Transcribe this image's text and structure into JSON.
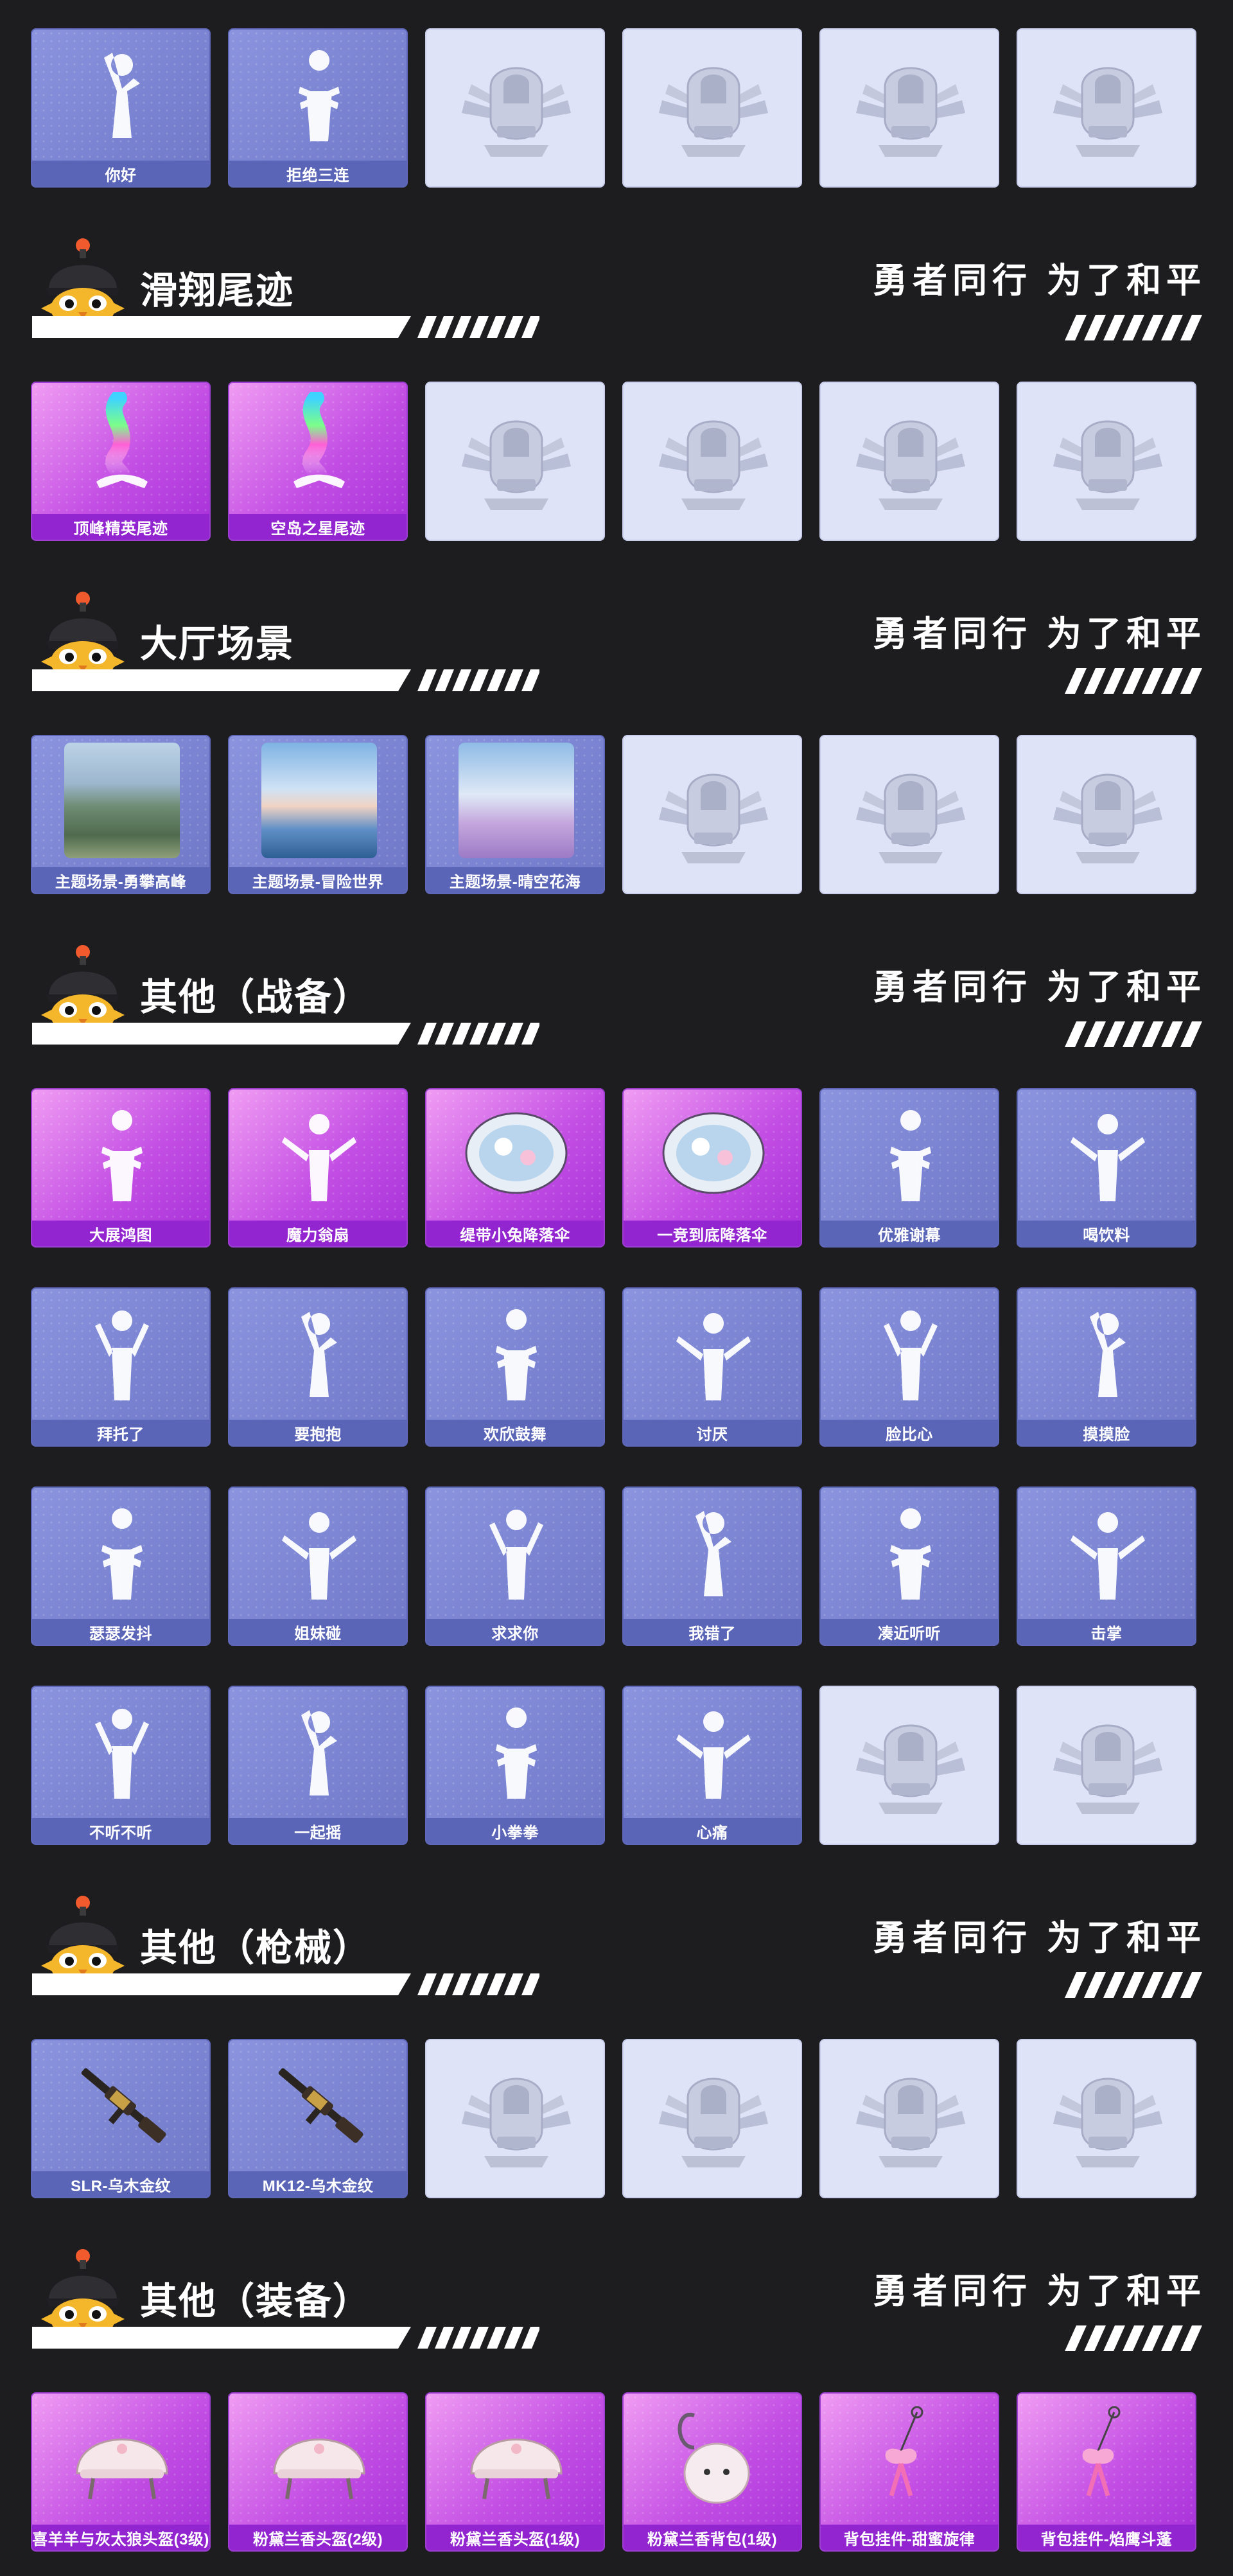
{
  "slogan": "勇者同行 为了和平",
  "sections": [
    {
      "title": "",
      "items": [
        {
          "label": "你好",
          "style": "blue",
          "icon": "wave-emote-icon"
        },
        {
          "label": "拒绝三连",
          "style": "blue",
          "icon": "crossed-arms-emote-icon"
        },
        {
          "label": "",
          "style": "empty",
          "icon": "helmet-emblem-icon"
        },
        {
          "label": "",
          "style": "empty",
          "icon": "helmet-emblem-icon"
        },
        {
          "label": "",
          "style": "empty",
          "icon": "helmet-emblem-icon"
        },
        {
          "label": "",
          "style": "empty",
          "icon": "helmet-emblem-icon"
        }
      ]
    },
    {
      "title": "滑翔尾迹",
      "items": [
        {
          "label": "顶峰精英尾迹",
          "style": "purple",
          "icon": "glide-trail-icon"
        },
        {
          "label": "空岛之星尾迹",
          "style": "purple",
          "icon": "glide-trail-icon"
        },
        {
          "label": "",
          "style": "empty",
          "icon": "helmet-emblem-icon"
        },
        {
          "label": "",
          "style": "empty",
          "icon": "helmet-emblem-icon"
        },
        {
          "label": "",
          "style": "empty",
          "icon": "helmet-emblem-icon"
        },
        {
          "label": "",
          "style": "empty",
          "icon": "helmet-emblem-icon"
        }
      ]
    },
    {
      "title": "大厅场景",
      "items": [
        {
          "label": "主题场景-勇攀高峰",
          "style": "blue",
          "icon": "mountain-scene-icon"
        },
        {
          "label": "主题场景-冒险世界",
          "style": "blue",
          "icon": "ocean-scene-icon"
        },
        {
          "label": "主题场景-晴空花海",
          "style": "blue",
          "icon": "flower-field-scene-icon"
        },
        {
          "label": "",
          "style": "empty",
          "icon": "helmet-emblem-icon"
        },
        {
          "label": "",
          "style": "empty",
          "icon": "helmet-emblem-icon"
        },
        {
          "label": "",
          "style": "empty",
          "icon": "helmet-emblem-icon"
        }
      ]
    },
    {
      "title": "其他（战备）",
      "items": [
        {
          "label": "大展鸿图",
          "style": "purple",
          "icon": "emote-icon"
        },
        {
          "label": "魔力翁扇",
          "style": "purple",
          "icon": "emote-icon"
        },
        {
          "label": "缇带小兔降落伞",
          "style": "purple",
          "icon": "parachute-icon"
        },
        {
          "label": "一竞到底降落伞",
          "style": "purple",
          "icon": "parachute-icon"
        },
        {
          "label": "优雅谢幕",
          "style": "blue",
          "icon": "bow-emote-icon"
        },
        {
          "label": "喝饮料",
          "style": "blue",
          "icon": "emote-icon"
        },
        {
          "label": "拜托了",
          "style": "blue",
          "icon": "emote-icon"
        },
        {
          "label": "要抱抱",
          "style": "blue",
          "icon": "emote-icon"
        },
        {
          "label": "欢欣鼓舞",
          "style": "blue",
          "icon": "emote-icon"
        },
        {
          "label": "讨厌",
          "style": "blue",
          "icon": "emote-icon"
        },
        {
          "label": "脸比心",
          "style": "blue",
          "icon": "emote-icon"
        },
        {
          "label": "摸摸脸",
          "style": "blue",
          "icon": "emote-icon"
        },
        {
          "label": "瑟瑟发抖",
          "style": "blue",
          "icon": "emote-icon"
        },
        {
          "label": "姐妹碰",
          "style": "blue",
          "icon": "emote-icon"
        },
        {
          "label": "求求你",
          "style": "blue",
          "icon": "emote-icon"
        },
        {
          "label": "我错了",
          "style": "blue",
          "icon": "emote-icon"
        },
        {
          "label": "凑近听听",
          "style": "blue",
          "icon": "emote-icon"
        },
        {
          "label": "击掌",
          "style": "blue",
          "icon": "emote-icon"
        },
        {
          "label": "不听不听",
          "style": "blue",
          "icon": "emote-icon"
        },
        {
          "label": "一起摇",
          "style": "blue",
          "icon": "emote-icon"
        },
        {
          "label": "小拳拳",
          "style": "blue",
          "icon": "emote-icon"
        },
        {
          "label": "心痛",
          "style": "blue",
          "icon": "emote-icon"
        },
        {
          "label": "",
          "style": "empty",
          "icon": "helmet-emblem-icon"
        },
        {
          "label": "",
          "style": "empty",
          "icon": "helmet-emblem-icon"
        }
      ]
    },
    {
      "title": "其他（枪械）",
      "items": [
        {
          "label": "SLR-乌木金纹",
          "style": "blue",
          "icon": "rifle-icon"
        },
        {
          "label": "MK12-乌木金纹",
          "style": "blue",
          "icon": "rifle-icon"
        },
        {
          "label": "",
          "style": "empty",
          "icon": "helmet-emblem-icon"
        },
        {
          "label": "",
          "style": "empty",
          "icon": "helmet-emblem-icon"
        },
        {
          "label": "",
          "style": "empty",
          "icon": "helmet-emblem-icon"
        },
        {
          "label": "",
          "style": "empty",
          "icon": "helmet-emblem-icon"
        }
      ]
    },
    {
      "title": "其他（装备）",
      "items": [
        {
          "label": "喜羊羊与灰太狼头盔(3级)",
          "style": "purple",
          "icon": "helmet-icon"
        },
        {
          "label": "粉黛兰香头盔(2级)",
          "style": "purple",
          "icon": "helmet-icon"
        },
        {
          "label": "粉黛兰香头盔(1级)",
          "style": "purple",
          "icon": "helmet-icon"
        },
        {
          "label": "粉黛兰香背包(1级)",
          "style": "purple",
          "icon": "backpack-icon"
        },
        {
          "label": "背包挂件-甜蜜旋律",
          "style": "purple",
          "icon": "charm-icon"
        },
        {
          "label": "背包挂件-焰鹰斗蓬",
          "style": "purple",
          "icon": "charm-icon"
        }
      ]
    }
  ]
}
